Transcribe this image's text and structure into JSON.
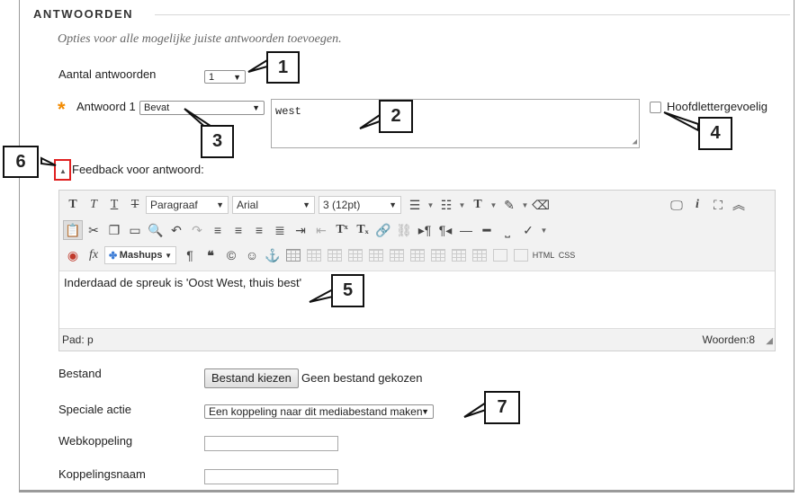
{
  "section": {
    "title": "ANTWOORDEN",
    "subtitle": "Opties voor alle mogelijke juiste antwoorden toevoegen."
  },
  "count": {
    "label": "Aantal antwoorden",
    "value": "1"
  },
  "answer": {
    "required_mark": "*",
    "label": "Antwoord 1",
    "match_type": "Bevat",
    "text": "west",
    "case_label": "Hoofdlettergevoelig",
    "case_checked": false
  },
  "feedback": {
    "label": "Feedback voor antwoord:"
  },
  "editor": {
    "paragraph": "Paragraaf",
    "font": "Arial",
    "size": "3 (12pt)",
    "mashups": "Mashups",
    "html_btn": "HTML",
    "css_btn": "CSS",
    "content": "Inderdaad de spreuk is 'Oost West, thuis best'",
    "path_label": "Pad: p",
    "word_count": "Woorden:8"
  },
  "file": {
    "label": "Bestand",
    "button": "Bestand kiezen",
    "status": "Geen bestand gekozen"
  },
  "special_action": {
    "label": "Speciale actie",
    "value": "Een koppeling naar dit mediabestand maken"
  },
  "web_link": {
    "label": "Webkoppeling",
    "value": ""
  },
  "link_name": {
    "label": "Koppelingsnaam",
    "value": ""
  },
  "callouts": [
    "1",
    "2",
    "3",
    "4",
    "5",
    "6",
    "7"
  ],
  "colors": {
    "required": "#f28a00",
    "callout_border": "#111111",
    "highlight": "#e02020"
  }
}
